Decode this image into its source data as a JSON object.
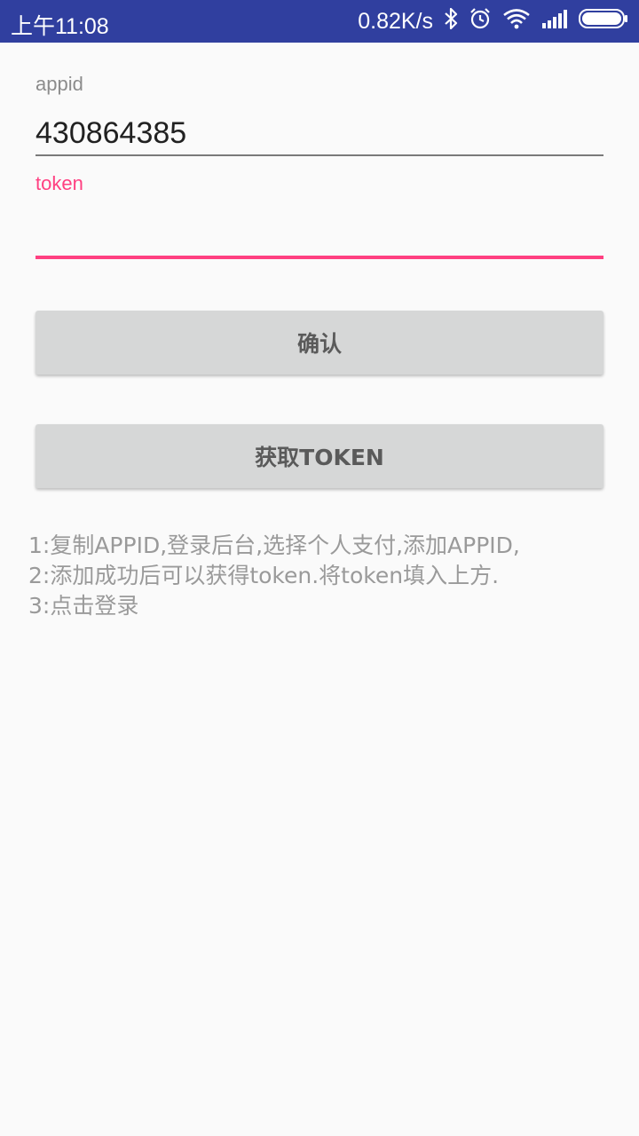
{
  "status_bar": {
    "time": "上午11:08",
    "net_speed": "0.82K/s",
    "icons": [
      "bluetooth-icon",
      "alarm-icon",
      "wifi-icon",
      "signal-icon",
      "battery-icon"
    ],
    "background": "#303f9f"
  },
  "form": {
    "appid": {
      "label": "appid",
      "value": "430864385"
    },
    "token": {
      "label": "token",
      "value": "",
      "accent": "#ff4081"
    }
  },
  "buttons": {
    "confirm": "确认",
    "get_token": "获取TOKEN"
  },
  "instructions": [
    "1:复制APPID,登录后台,选择个人支付,添加APPID,",
    "2:添加成功后可以获得token.将token填入上方.",
    "3:点击登录"
  ]
}
